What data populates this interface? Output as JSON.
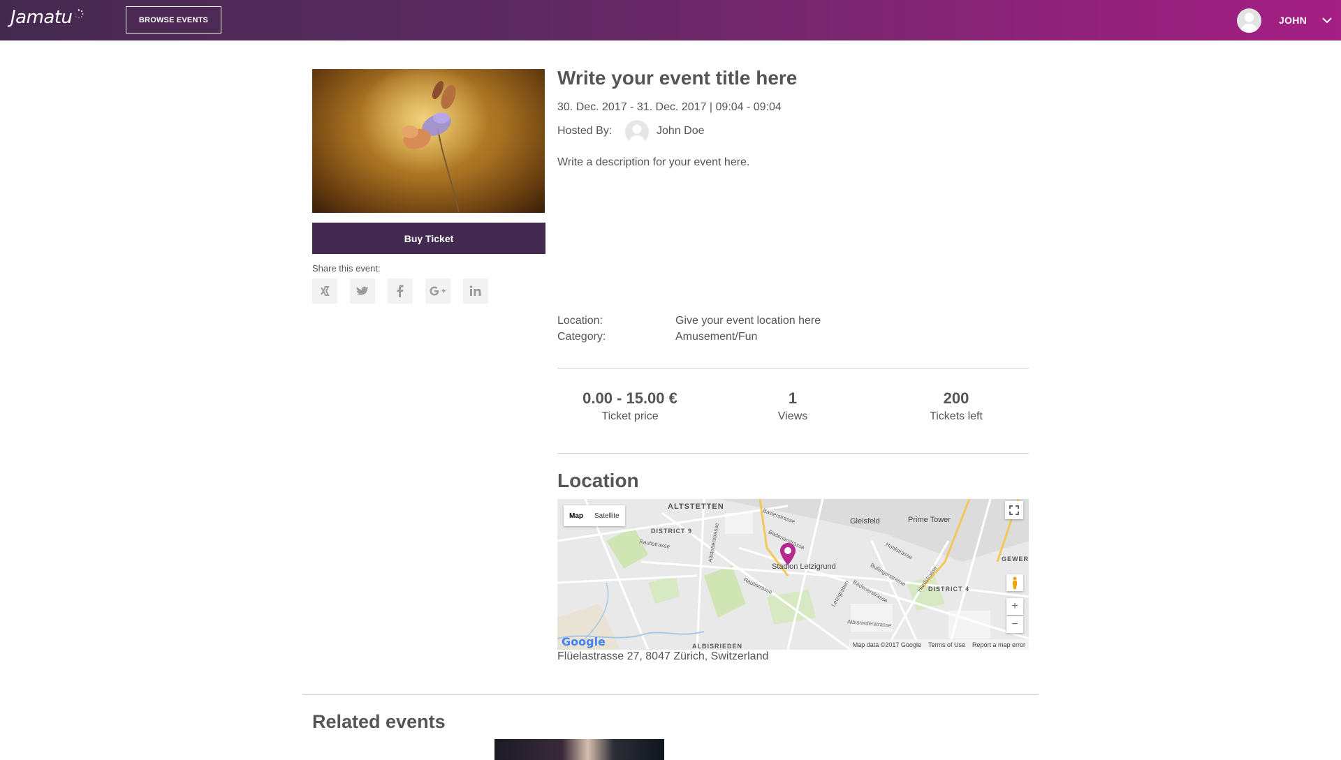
{
  "navbar": {
    "logo_text": "Jamatu",
    "browse_label": "BROWSE EVENTS",
    "user_name": "JOHN"
  },
  "event": {
    "title": "Write your event title here",
    "date_time": "30. Dec. 2017 - 31. Dec. 2017 | 09:04 - 09:04",
    "hosted_by_label": "Hosted By:",
    "host_name": "John Doe",
    "description": "Write a description for your event here.",
    "buy_ticket_label": "Buy Ticket",
    "share_label": "Share this event:",
    "share_icons": [
      "xing-icon",
      "twitter-icon",
      "facebook-icon",
      "google-plus-icon",
      "linkedin-icon"
    ]
  },
  "details": {
    "location_label": "Location:",
    "location_value": "Give your event location here",
    "category_label": "Category:",
    "category_value": "Amusement/Fun"
  },
  "stats": [
    {
      "value": "0.00 - 15.00 €",
      "label": "Ticket price"
    },
    {
      "value": "1",
      "label": "Views"
    },
    {
      "value": "200",
      "label": "Tickets left"
    }
  ],
  "location_section": {
    "heading": "Location",
    "address": "Flüelastrasse 27, 8047 Zürich, Switzerland"
  },
  "map": {
    "type_map": "Map",
    "type_satellite": "Satellite",
    "labels": {
      "altstetten": "ALTSTETTEN",
      "district9": "DISTRICT 9",
      "district4": "DISTRICT 4",
      "gleisfeld": "Gleisfeld",
      "prime_tower": "Prime Tower",
      "stadion": "Stadion Letzigrund",
      "gewer": "GEWER",
      "albisrieden": "ALBISRIEDEN",
      "baslerstrasse": "Baslerstrasse",
      "badenerstrasse": "Badenerstrasse",
      "rautistrasse": "Rautistrasse",
      "altstetterstrasse": "Altstetterstrasse",
      "hohlstrasse": "Hohlstrasse",
      "bullingerstrasse": "Bullingerstrasse",
      "hardstrasse": "Hardstrasse",
      "letzigraben": "Letzigraben",
      "albisriederstrasse": "Albisriederstrasse"
    },
    "zoom_in": "+",
    "zoom_out": "−",
    "google": "Google",
    "map_data": "Map data ©2017 Google",
    "terms": "Terms of Use",
    "report": "Report a map error"
  },
  "related": {
    "heading": "Related events"
  },
  "colors": {
    "nav_start": "#44294f",
    "nav_end": "#a51f85",
    "buy_button": "#42294f",
    "pin": "#b52a8f"
  }
}
